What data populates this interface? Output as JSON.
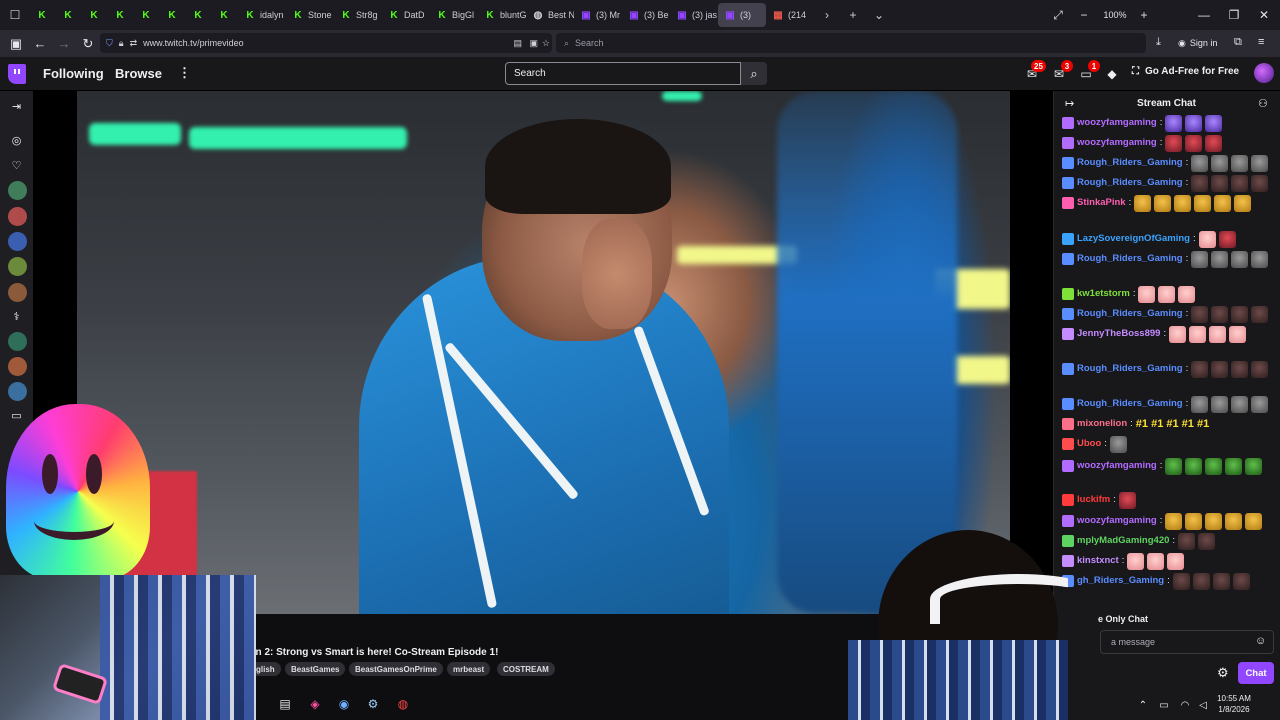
{
  "browser": {
    "tabs": [
      {
        "label": "",
        "icon": "kick-icon",
        "color": "#53fc18"
      },
      {
        "label": "",
        "icon": "kick-icon",
        "color": "#53fc18"
      },
      {
        "label": "",
        "icon": "kick-icon",
        "color": "#53fc18"
      },
      {
        "label": "",
        "icon": "kick-icon",
        "color": "#53fc18"
      },
      {
        "label": "",
        "icon": "kick-icon",
        "color": "#53fc18"
      },
      {
        "label": "",
        "icon": "kick-icon",
        "color": "#53fc18"
      },
      {
        "label": "",
        "icon": "kick-icon",
        "color": "#53fc18"
      },
      {
        "label": "",
        "icon": "kick-icon",
        "color": "#53fc18"
      },
      {
        "label": "idalyn",
        "icon": "kick-icon",
        "color": "#53fc18"
      },
      {
        "label": "Stone",
        "icon": "kick-icon",
        "color": "#53fc18"
      },
      {
        "label": "Str8g",
        "icon": "kick-icon",
        "color": "#53fc18"
      },
      {
        "label": "DatD",
        "icon": "kick-icon",
        "color": "#53fc18"
      },
      {
        "label": "BigGl",
        "icon": "kick-icon",
        "color": "#53fc18"
      },
      {
        "label": "bluntG",
        "icon": "kick-icon",
        "color": "#53fc18"
      },
      {
        "label": "Best N",
        "icon": "globe-icon",
        "color": "#cfcfd8"
      },
      {
        "label": "(3) Mr",
        "icon": "twitch-icon",
        "color": "#9147ff"
      },
      {
        "label": "(3) Be",
        "icon": "twitch-icon",
        "color": "#9147ff"
      },
      {
        "label": "(3) jas",
        "icon": "twitch-icon",
        "color": "#9147ff"
      },
      {
        "label": "(3)",
        "icon": "twitch-icon",
        "color": "#9147ff"
      },
      {
        "label": "(214",
        "icon": "folder-icon",
        "color": "#e3564a"
      }
    ],
    "zoom": "100%",
    "url": "www.twitch.tv/primevideo",
    "search_placeholder": "Search",
    "sign_in": "Sign in"
  },
  "twitch": {
    "nav": {
      "following": "Following",
      "browse": "Browse",
      "more": "⋮"
    },
    "search_placeholder": "Search",
    "badges": {
      "inbox": "25",
      "whispers": "3",
      "notifications": "1"
    },
    "ad_free": "Go Ad-Free for Free",
    "accent": "#9147ff"
  },
  "stream": {
    "title": "en 2: Strong vs Smart is here! Co-Stream Episode 1!",
    "tags": [
      "glish",
      "BeastGames",
      "BeastGamesOnPrime",
      "mrbeast",
      "COSTREAM"
    ]
  },
  "chat": {
    "header": "Stream Chat",
    "messages": [
      {
        "user": "woozyfamgaming",
        "sep": ":",
        "color": "#b26bff",
        "emotes": [
          "purple",
          "purple",
          "purple"
        ]
      },
      {
        "user": "woozyfamgaming",
        "sep": ":",
        "color": "#b26bff",
        "emotes": [
          "red",
          "red",
          "red"
        ]
      },
      {
        "user": "Rough_Riders_Gaming",
        "sep": ":",
        "color": "#5a8dff",
        "emotes": [
          "grey",
          "grey",
          "grey",
          "grey"
        ]
      },
      {
        "user": "Rough_Riders_Gaming",
        "sep": ":",
        "color": "#5a8dff",
        "emotes": [
          "bat",
          "bat",
          "bat",
          "bat"
        ]
      },
      {
        "user": "StinkaPink",
        "sep": ":",
        "color": "#ff5fb1",
        "emotes": [
          "gold",
          "gold",
          "gold",
          "gold",
          "gold",
          "gold"
        ]
      },
      {
        "user": "LazySovereignOfGaming",
        "sep": ":",
        "color": "#3aa3ff",
        "emotes": [
          "pink",
          "red"
        ]
      },
      {
        "user": "Rough_Riders_Gaming",
        "sep": ":",
        "color": "#5a8dff",
        "emotes": [
          "grey",
          "grey",
          "grey",
          "grey"
        ]
      },
      {
        "user": "kw1etstorm",
        "sep": ":",
        "color": "#7fe03a",
        "emotes": [
          "pink",
          "pink",
          "pink"
        ]
      },
      {
        "user": "Rough_Riders_Gaming",
        "sep": ":",
        "color": "#5a8dff",
        "emotes": [
          "bat",
          "bat",
          "bat",
          "bat"
        ]
      },
      {
        "user": "JennyTheBoss899",
        "sep": ":",
        "color": "#c48cff",
        "emotes": [
          "pink",
          "pink",
          "pink",
          "pink"
        ]
      },
      {
        "user": "Rough_Riders_Gaming",
        "sep": ":",
        "color": "#5a8dff",
        "emotes": [
          "bat",
          "bat",
          "bat",
          "bat"
        ]
      },
      {
        "user": "Rough_Riders_Gaming",
        "sep": ":",
        "color": "#5a8dff",
        "emotes": [
          "grey",
          "grey",
          "grey",
          "grey"
        ]
      },
      {
        "user": "mixonelion",
        "sep": ":",
        "color": "#ff6f8a",
        "text": "#1 #1 #1 #1 #1"
      },
      {
        "user": "Uboo",
        "sep": ":",
        "color": "#ff4d4d",
        "emotes": [
          "grey"
        ]
      },
      {
        "user": "woozyfamgaming",
        "sep": ":",
        "color": "#b26bff",
        "emotes": [
          "green",
          "green",
          "green",
          "green",
          "green"
        ]
      },
      {
        "user": "luckifm",
        "sep": ":",
        "color": "#ff3b3b",
        "emotes": [
          "red"
        ]
      },
      {
        "user": "woozyfamgaming",
        "sep": ":",
        "color": "#b26bff",
        "emotes": [
          "gold",
          "gold",
          "gold",
          "gold",
          "gold"
        ]
      },
      {
        "user": "mplyMadGaming420",
        "sep": ":",
        "color": "#5fd35f",
        "emotes": [
          "bat",
          "bat"
        ]
      },
      {
        "user": "kinstxnct",
        "sep": ":",
        "color": "#c48cff",
        "emotes": [
          "pink",
          "pink",
          "pink"
        ]
      },
      {
        "user": "gh_Riders_Gaming",
        "sep": ":",
        "color": "#5a8dff",
        "emotes": [
          "bat",
          "bat",
          "bat",
          "bat"
        ]
      }
    ],
    "emote_only": "e Only Chat",
    "input_placeholder": "a message",
    "chat_button": "Chat"
  },
  "taskbar": {
    "time": "10:55 AM",
    "date": "1/8/2026"
  }
}
